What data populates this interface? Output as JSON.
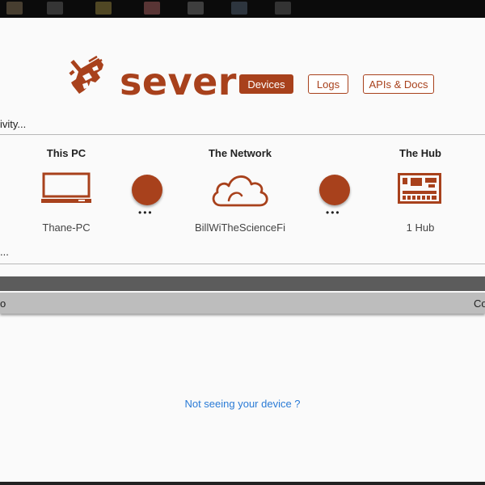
{
  "app": {
    "name": "sever",
    "brand_color": "#a8411c",
    "link_color": "#2a7bd6"
  },
  "nav": {
    "devices": "Devices",
    "logs": "Logs",
    "apis_docs": "APIs & Docs",
    "active": "Devices"
  },
  "status": {
    "line1": "ivity...",
    "line2": "..."
  },
  "topology": {
    "pc": {
      "title": "This PC",
      "name": "Thane-PC",
      "icon": "laptop-icon"
    },
    "network": {
      "title": "The Network",
      "name": "BillWiTheScienceFi",
      "icon": "cloud-icon"
    },
    "hub": {
      "title": "The Hub",
      "name": "1 Hub",
      "icon": "hub-board-icon"
    },
    "connector_dots": "•••"
  },
  "table_header": {
    "left": "o",
    "right": "Co"
  },
  "help": {
    "link_text": "Not seeing your device ?"
  }
}
